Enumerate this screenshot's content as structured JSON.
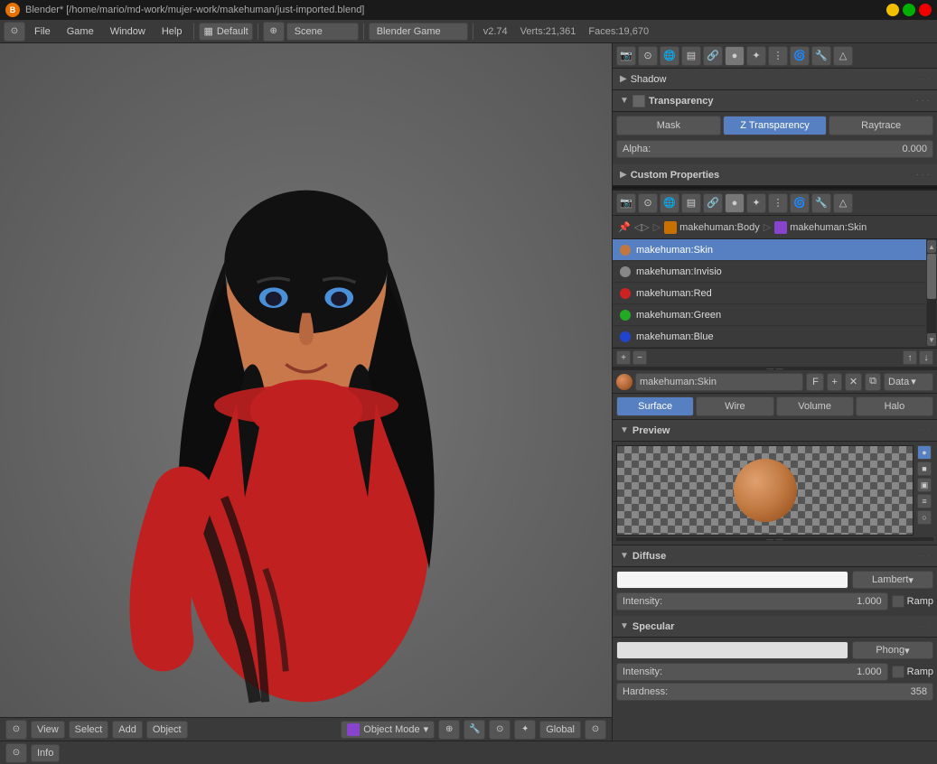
{
  "titlebar": {
    "title": "Blender* [/home/mario/md-work/mujer-work/makehuman/just-imported.blend]",
    "icon": "B"
  },
  "menubar": {
    "file": "File",
    "game": "Game",
    "window": "Window",
    "help": "Help",
    "layout": "Default",
    "scene": "Scene",
    "engine": "Blender Game",
    "version": "v2.74",
    "verts": "Verts:21,361",
    "faces": "Faces:19,670"
  },
  "viewport": {
    "bottom_bar": {
      "view": "View",
      "select": "Select",
      "add": "Add",
      "object": "Object",
      "mode": "Object Mode",
      "global": "Global"
    }
  },
  "properties_toolbar": {
    "icons": [
      "⊙",
      "📷",
      "△",
      "⚙",
      "🔴",
      "💠",
      "🔗",
      "🔧",
      "🌊",
      "✨",
      "◉",
      "📷",
      "⚡",
      "🎯"
    ]
  },
  "shadow_section": {
    "label": "Shadow",
    "collapsed": true
  },
  "transparency_section": {
    "label": "Transparency",
    "tabs": [
      "Mask",
      "Z Transparency",
      "Raytrace"
    ],
    "active_tab": "Z Transparency",
    "alpha_label": "Alpha:",
    "alpha_value": "0.000"
  },
  "custom_properties": {
    "label": "Custom Properties"
  },
  "materials_toolbar": {
    "icons": [
      "⊙",
      "📷",
      "△",
      "⚙",
      "🔴",
      "💠",
      "🔗",
      "🔧",
      "🌊",
      "✨",
      "◉",
      "📷"
    ]
  },
  "breadcrumb": {
    "items": [
      "makehuman:Body",
      "makehuman:Skin"
    ]
  },
  "material_list": {
    "items": [
      {
        "name": "makehuman:Skin",
        "active": true
      },
      {
        "name": "makehuman:Invisio",
        "active": false
      },
      {
        "name": "makehuman:Red",
        "active": false
      },
      {
        "name": "makehuman:Green",
        "active": false
      },
      {
        "name": "makehuman:Blue",
        "active": false
      }
    ]
  },
  "material_bar": {
    "name": "makehuman:Skin",
    "f_label": "F",
    "data_label": "Data"
  },
  "mat_tabs": {
    "tabs": [
      "Surface",
      "Wire",
      "Volume",
      "Halo"
    ],
    "active": "Surface"
  },
  "preview": {
    "label": "Preview"
  },
  "diffuse": {
    "label": "Diffuse",
    "shader": "Lambert",
    "intensity_label": "Intensity:",
    "intensity_value": "1.000",
    "ramp_label": "Ramp"
  },
  "specular": {
    "label": "Specular",
    "shader": "Phong",
    "intensity_label": "Intensity:",
    "intensity_value": "1.000",
    "ramp_label": "Ramp",
    "hardness_label": "Hardness:",
    "hardness_value": "358"
  },
  "bottom_bar": {
    "icon": "⊙"
  }
}
